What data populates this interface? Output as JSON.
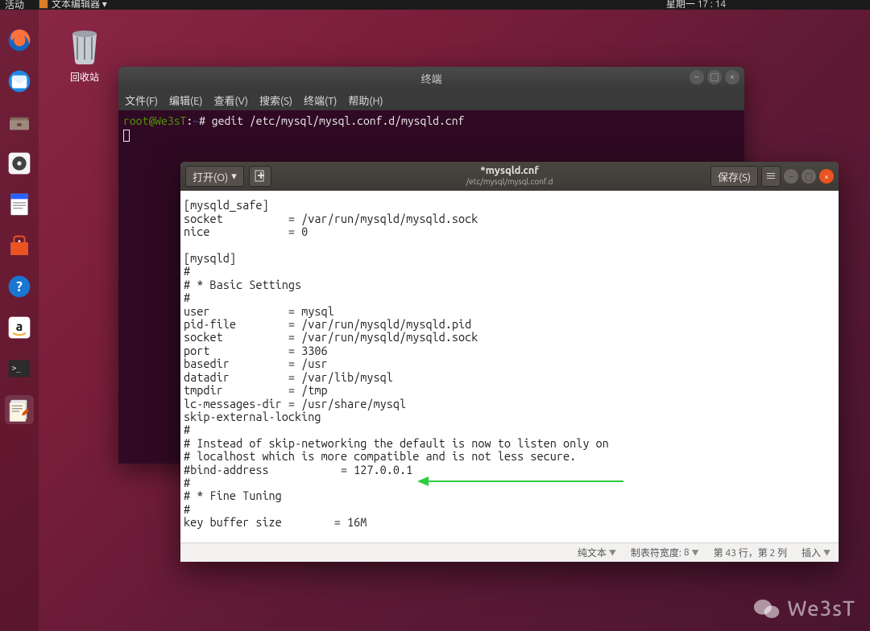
{
  "top_panel": {
    "activities": "活动",
    "app_label": "文本编辑器 ▾",
    "datetime": "星期一 17 : 14"
  },
  "desktop": {
    "trash_label": "回收站"
  },
  "terminal": {
    "title": "终端",
    "menu": {
      "file": "文件(F)",
      "edit": "编辑(E)",
      "view": "查看(V)",
      "search": "搜索(S)",
      "terminal": "终端(T)",
      "help": "帮助(H)"
    },
    "prompt_user": "root@We3sT",
    "prompt_sep": ":",
    "prompt_path": "~",
    "prompt_sym": "# ",
    "command": "gedit /etc/mysql/mysql.conf.d/mysqld.cnf"
  },
  "gedit": {
    "open_label": "打开(O)",
    "save_label": "保存(S)",
    "file_name": "*mysqld.cnf",
    "file_path": "/etc/mysql/mysql.conf.d",
    "content_lines": [
      "",
      "[mysqld_safe]",
      "socket          = /var/run/mysqld/mysqld.sock",
      "nice            = 0",
      "",
      "[mysqld]",
      "#",
      "# * Basic Settings",
      "#",
      "user            = mysql",
      "pid-file        = /var/run/mysqld/mysqld.pid",
      "socket          = /var/run/mysqld/mysqld.sock",
      "port            = 3306",
      "basedir         = /usr",
      "datadir         = /var/lib/mysql",
      "tmpdir          = /tmp",
      "lc-messages-dir = /usr/share/mysql",
      "skip-external-locking",
      "#",
      "# Instead of skip-networking the default is now to listen only on",
      "# localhost which is more compatible and is not less secure.",
      "#bind-address           = 127.0.0.1",
      "#",
      "# * Fine Tuning",
      "#",
      "key buffer size        = 16M"
    ],
    "status": {
      "syntax": "纯文本",
      "tab_width_label": "制表符宽度:",
      "tab_width_value": "8",
      "position": "第 43 行，第 2 列",
      "mode": "插入"
    }
  },
  "watermark": {
    "text": "We3sT"
  }
}
